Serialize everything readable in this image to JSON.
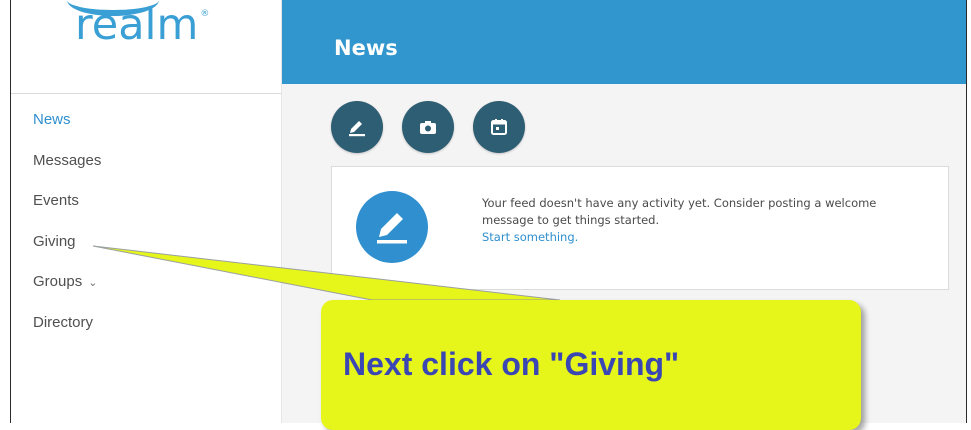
{
  "sidebar": {
    "logo_text": "realm",
    "logo_mark": "®",
    "items": [
      {
        "label": "News",
        "active": true
      },
      {
        "label": "Messages"
      },
      {
        "label": "Events"
      },
      {
        "label": "Giving"
      },
      {
        "label": "Groups",
        "has_dropdown": true
      },
      {
        "label": "Directory"
      }
    ]
  },
  "header": {
    "title": "News"
  },
  "actions": [
    {
      "icon": "pencil-icon"
    },
    {
      "icon": "camera-icon"
    },
    {
      "icon": "calendar-icon"
    }
  ],
  "feed": {
    "message": "Your feed doesn't have any activity yet. Consider posting a welcome message to get things started.",
    "link": "Start something."
  },
  "callout": {
    "text": "Next click on \"Giving\""
  },
  "colors": {
    "brand": "#3096cd",
    "accent": "#2f8fcf",
    "action_button": "#2e5e73",
    "callout_bg": "#e6f51a",
    "callout_text": "#3a46b4"
  }
}
